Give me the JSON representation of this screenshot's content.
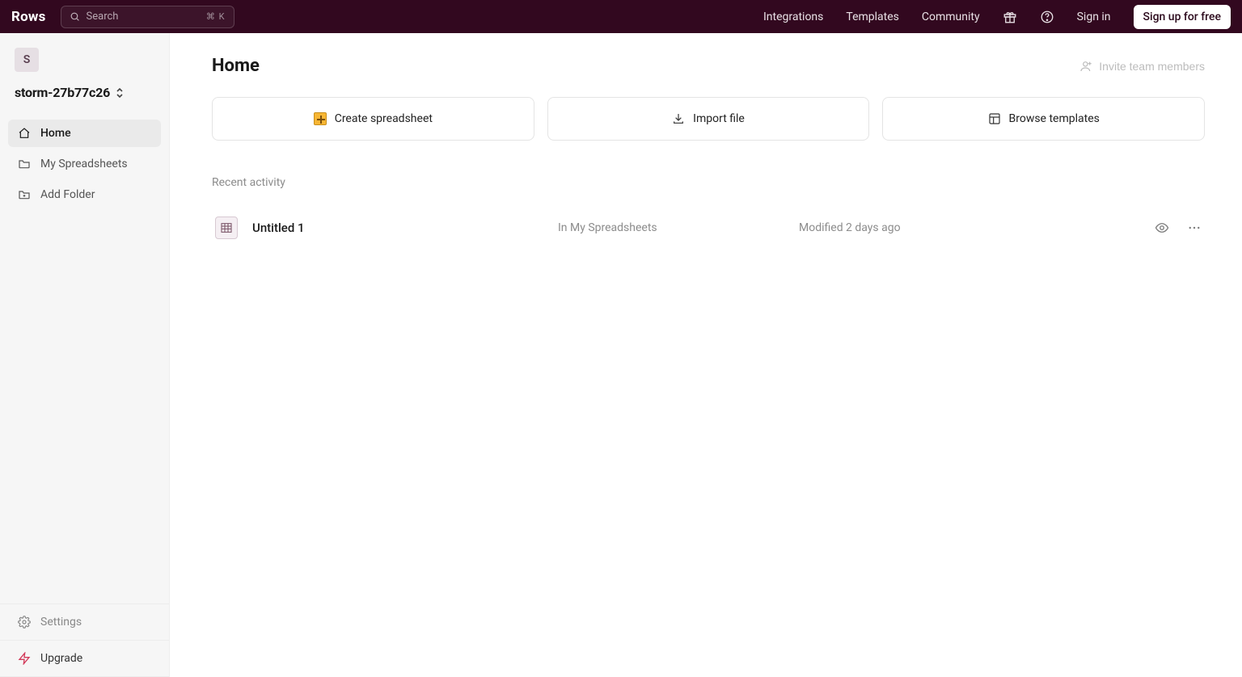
{
  "header": {
    "logo": "Rows",
    "search_placeholder": "Search",
    "search_shortcut": "⌘ K",
    "nav": {
      "integrations": "Integrations",
      "templates": "Templates",
      "community": "Community",
      "sign_in": "Sign in",
      "sign_up": "Sign up for free"
    }
  },
  "sidebar": {
    "workspace_initial": "S",
    "workspace_name": "storm-27b77c26",
    "items": [
      {
        "label": "Home"
      },
      {
        "label": "My Spreadsheets"
      },
      {
        "label": "Add Folder"
      }
    ],
    "settings_label": "Settings",
    "upgrade_label": "Upgrade"
  },
  "main": {
    "title": "Home",
    "invite_label": "Invite team members",
    "actions": {
      "create": "Create spreadsheet",
      "import": "Import file",
      "browse": "Browse templates"
    },
    "recent_label": "Recent activity",
    "recent_items": [
      {
        "name": "Untitled 1",
        "location": "In My Spreadsheets",
        "modified": "Modified 2 days ago"
      }
    ]
  }
}
